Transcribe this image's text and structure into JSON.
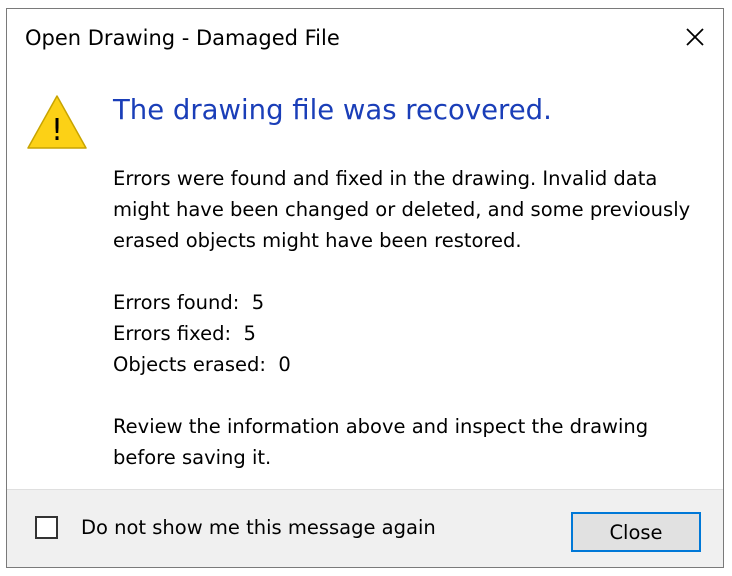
{
  "window": {
    "title": "Open Drawing - Damaged File",
    "close_icon": "close-x-icon"
  },
  "icon": {
    "name": "warning-icon",
    "glyph": "!",
    "fill_color": "#fcd116"
  },
  "main_instruction": "The drawing file was recovered.",
  "main_instruction_color": "#1a3eb8",
  "description": "Errors were found and fixed in the drawing. Invalid data might have been changed or deleted, and some previously erased objects might have been restored.",
  "stats": [
    {
      "label": "Errors found:",
      "value": "5"
    },
    {
      "label": "Errors fixed:",
      "value": "5"
    },
    {
      "label": "Objects erased:",
      "value": "0"
    }
  ],
  "review_text": "Review the information above and inspect the drawing before saving it.",
  "footer": {
    "checkbox_label": "Do not show me this message again",
    "checkbox_checked": false,
    "close_button_label": "Close",
    "accent_color": "#0078d7"
  }
}
